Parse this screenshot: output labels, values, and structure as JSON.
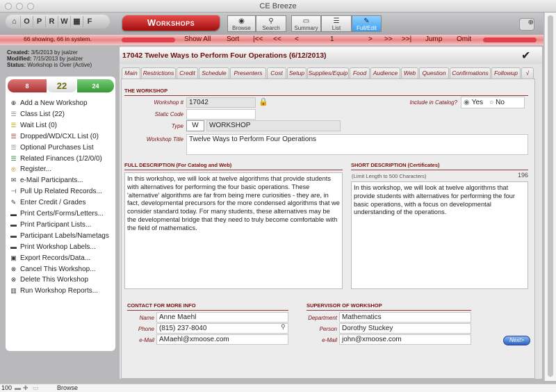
{
  "window": {
    "title": "CE Breeze"
  },
  "quick_nav": [
    "⌂",
    "O",
    "P",
    "R",
    "W",
    "▦",
    "F"
  ],
  "module_button": "Workshops",
  "view_buttons": [
    {
      "label": "Browse",
      "icon": "eye-icon"
    },
    {
      "label": "Search",
      "icon": "search-icon"
    },
    {
      "label": "Summary",
      "icon": "summary-icon"
    },
    {
      "label": "List",
      "icon": "list-icon"
    },
    {
      "label": "Full/Edit",
      "icon": "edit-icon"
    }
  ],
  "navbar": {
    "count": "66 showing, 66 in system.",
    "show_all": "Show All",
    "sort": "Sort",
    "first": "|<<",
    "prev_page": "<<",
    "prev": "<",
    "record": "1",
    "next": ">",
    "next_page": ">>",
    "last": ">>|",
    "jump": "Jump",
    "omit": "Omit"
  },
  "record_info": {
    "created_label": "Created:",
    "created": "3/5/2013 by jsalzer",
    "modified_label": "Modified:",
    "modified": "7/15/2013 by jsalzer",
    "status_label": "Status:",
    "status": "Workshop is Over (Active)"
  },
  "counter": {
    "left": "8",
    "center": "22",
    "right": "24"
  },
  "menu": [
    {
      "label": "Add a New Workshop",
      "icon": "plus-circle-icon",
      "glyph": "⊕",
      "color": "#222"
    },
    {
      "label": "Class List (22)",
      "icon": "list-icon",
      "glyph": "☰",
      "color": "#888"
    },
    {
      "label": "Wait List (0)",
      "icon": "list-icon",
      "glyph": "☰",
      "color": "#b5b200"
    },
    {
      "label": "Dropped/WD/CXL List (0)",
      "icon": "list-icon",
      "glyph": "☰",
      "color": "#a33"
    },
    {
      "label": "Optional Purchases List",
      "icon": "list-icon",
      "glyph": "☰",
      "color": "#888"
    },
    {
      "label": "Related Finances (1/2/0/0)",
      "icon": "list-icon",
      "glyph": "☰",
      "color": "#2a8a2a"
    },
    {
      "label": "Register...",
      "icon": "register-icon",
      "glyph": "®",
      "color": "#c8892a"
    },
    {
      "label": "e-Mail Participants...",
      "icon": "envelope-icon",
      "glyph": "✉",
      "color": "#333"
    },
    {
      "label": "Pull Up Related Records...",
      "icon": "related-records-icon",
      "glyph": "⊣",
      "color": "#333"
    },
    {
      "label": "Enter Credit / Grades",
      "icon": "pencil-icon",
      "glyph": "✎",
      "color": "#333"
    },
    {
      "label": "Print Certs/Forms/Letters...",
      "icon": "printer-icon",
      "glyph": "▬",
      "color": "#333"
    },
    {
      "label": "Print Participant Lists...",
      "icon": "printer-icon",
      "glyph": "▬",
      "color": "#333"
    },
    {
      "label": "Participant Labels/Nametags",
      "icon": "printer-icon",
      "glyph": "▬",
      "color": "#333"
    },
    {
      "label": "Print Workshop Labels...",
      "icon": "printer-icon",
      "glyph": "▬",
      "color": "#333"
    },
    {
      "label": "Export Records/Data...",
      "icon": "briefcase-icon",
      "glyph": "▣",
      "color": "#333"
    },
    {
      "label": "Cancel This Workshop...",
      "icon": "x-circle-icon",
      "glyph": "⊗",
      "color": "#333"
    },
    {
      "label": "Delete This Workshop",
      "icon": "x-circle-icon",
      "glyph": "⊗",
      "color": "#333"
    },
    {
      "label": "Run Workshop Reports...",
      "icon": "bar-chart-icon",
      "glyph": "▥",
      "color": "#333"
    }
  ],
  "record_header": "17042  Twelve Ways to Perform Four Operations  (6/12/2013)",
  "tabs": [
    "Main",
    "Restrictions",
    "Credit",
    "Schedule",
    "Presenters",
    "Cost",
    "Setup",
    "Supplies/Equip",
    "Food",
    "Audience",
    "Web",
    "Question",
    "Confirmations",
    "Followup",
    "√"
  ],
  "active_tab": "Main",
  "workshop": {
    "heading": "THE WORKSHOP",
    "number_label": "Workshop #",
    "number": "17042",
    "static_code_label": "Static Code",
    "static_code": "",
    "type_label": "Type",
    "type_code": "W",
    "type_name": "WORKSHOP",
    "title_label": "Workshop Title",
    "title": "Twelve Ways to Perform Four Operations",
    "catalog_label": "Include in Catalog?",
    "catalog_yes": "Yes",
    "catalog_no": "No",
    "catalog_value": "Yes"
  },
  "full_description": {
    "heading": "FULL DESCRIPTION (For Catalog and Web)",
    "text": "In this workshop, we will look at twelve algorithms that provide students with alternatives for performing the four basic operations.  These 'alternative' algorithms are far from being mere curiosities - they are, in fact, developmental precursors for the more condensed algorithms that we consider standard today.  For many students, these alternatives may be the developmental bridge that they need to truly become comfortable with the field of mathematics."
  },
  "short_description": {
    "heading": "SHORT DESCRIPTION (Certificates)",
    "limit": "(Limit Length to 500 Characters)",
    "count": "196",
    "text": "In this workshop, we will look at twelve algorithms that provide students with alternatives for performing the four basic operations, with a focus on developmental understanding of the operations."
  },
  "contact": {
    "heading": "CONTACT FOR MORE INFO",
    "name_label": "Name",
    "name": "Anne Maehl",
    "phone_label": "Phone",
    "phone": "(815) 237-8040",
    "email_label": "e-Mail",
    "email": "AMaehl@xmoose.com"
  },
  "supervisor": {
    "heading": "SUPERVISOR OF WORKSHOP",
    "department_label": "Department",
    "department": "Mathematics",
    "person_label": "Person",
    "person": "Dorothy Stuckey",
    "email_label": "e-Mail",
    "email": "john@xmoose.com"
  },
  "next_button": "Next>",
  "status_bar": {
    "zoom": "100",
    "mode": "Browse"
  }
}
